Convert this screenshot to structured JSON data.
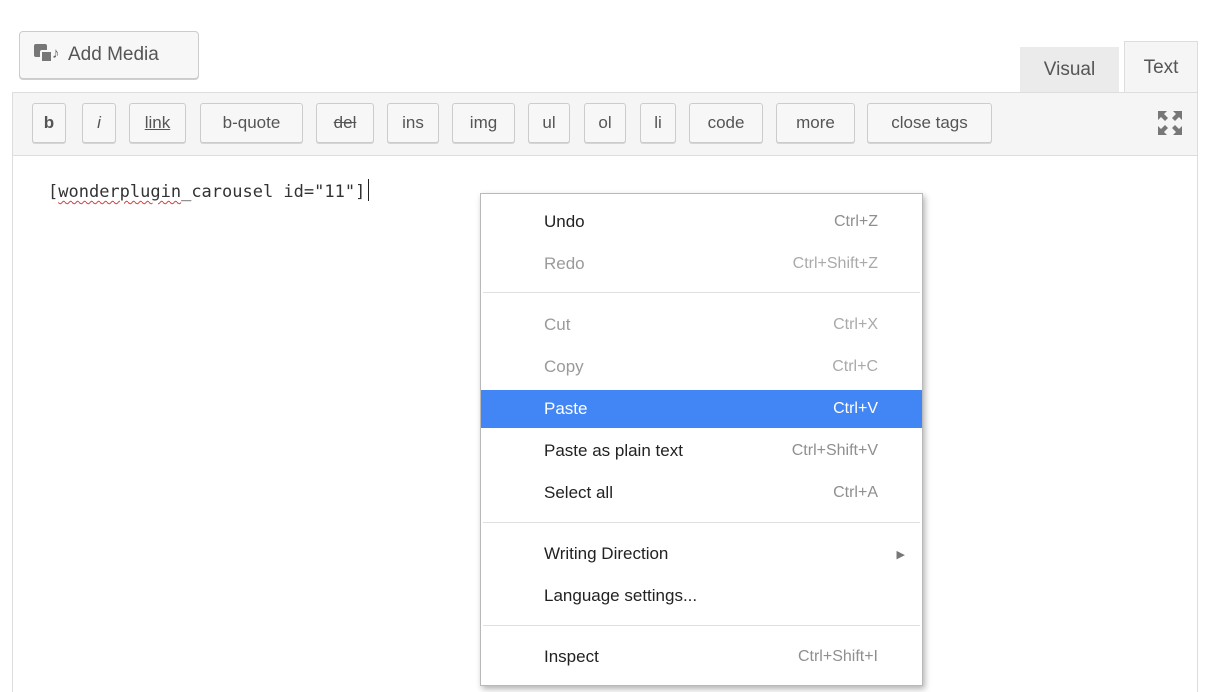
{
  "add_media": {
    "label": "Add Media",
    "icon": "add-media-icon"
  },
  "tabs": {
    "visual": "Visual",
    "text": "Text"
  },
  "toolbar": {
    "buttons": [
      "b",
      "i",
      "link",
      "b-quote",
      "del",
      "ins",
      "img",
      "ul",
      "ol",
      "li",
      "code",
      "more",
      "close tags"
    ],
    "fullscreen_icon": "fullscreen-icon"
  },
  "editor": {
    "content_prefix": "[",
    "content_misspelled": "wonderplugin",
    "content_rest": "_carousel id=\"11\"]"
  },
  "context_menu": {
    "undo": {
      "label": "Undo",
      "shortcut": "Ctrl+Z"
    },
    "redo": {
      "label": "Redo",
      "shortcut": "Ctrl+Shift+Z"
    },
    "cut": {
      "label": "Cut",
      "shortcut": "Ctrl+X"
    },
    "copy": {
      "label": "Copy",
      "shortcut": "Ctrl+C"
    },
    "paste": {
      "label": "Paste",
      "shortcut": "Ctrl+V"
    },
    "paste_plain": {
      "label": "Paste as plain text",
      "shortcut": "Ctrl+Shift+V"
    },
    "select_all": {
      "label": "Select all",
      "shortcut": "Ctrl+A"
    },
    "writing_direction": {
      "label": "Writing Direction"
    },
    "language_settings": {
      "label": "Language settings..."
    },
    "inspect": {
      "label": "Inspect",
      "shortcut": "Ctrl+Shift+I"
    },
    "highlight_color": "#4285f4"
  }
}
